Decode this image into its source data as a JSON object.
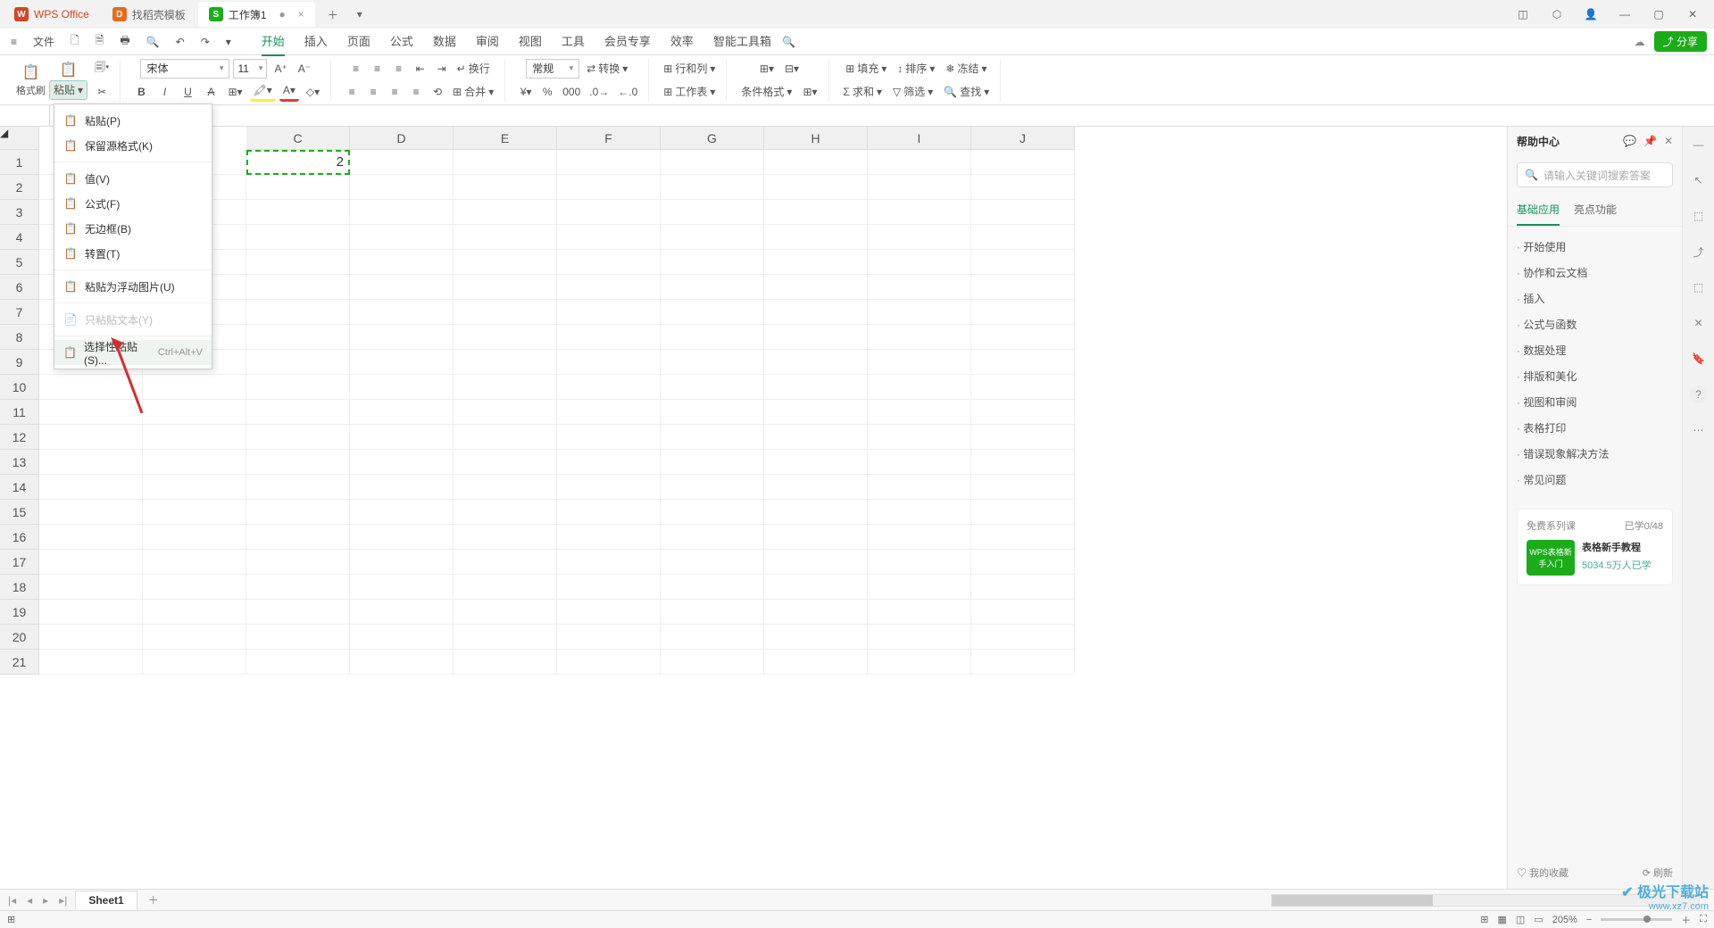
{
  "titlebar": {
    "app_name": "WPS Office",
    "template_tab": "找稻壳模板",
    "doc_tab": "工作簿1"
  },
  "file_menu_label": "文件",
  "menu_tabs": [
    "开始",
    "插入",
    "页面",
    "公式",
    "数据",
    "审阅",
    "视图",
    "工具",
    "会员专享",
    "效率",
    "智能工具箱"
  ],
  "active_menu_tab": 0,
  "share_label": "分享",
  "ribbon": {
    "format_painter": "格式刷",
    "paste": "粘贴",
    "font_name": "宋体",
    "font_size": "11",
    "wrap": "换行",
    "number_format": "常规",
    "convert": "转换",
    "rowcol": "行和列",
    "worksheet": "工作表",
    "cond_format": "条件格式",
    "fill": "填充",
    "sort": "排序",
    "freeze": "冻结",
    "sum": "求和",
    "filter": "筛选",
    "find": "查找",
    "merge": "合并"
  },
  "paste_menu": {
    "items": [
      {
        "label": "粘贴(P)",
        "icon": "📋"
      },
      {
        "label": "保留源格式(K)",
        "icon": "📋"
      },
      {
        "label": "值(V)",
        "icon": "📋"
      },
      {
        "label": "公式(F)",
        "icon": "📋"
      },
      {
        "label": "无边框(B)",
        "icon": "📋"
      },
      {
        "label": "转置(T)",
        "icon": "📋"
      },
      {
        "label": "粘贴为浮动图片(U)",
        "icon": "📋"
      },
      {
        "label": "只粘贴文本(Y)",
        "icon": "📄",
        "disabled": true
      },
      {
        "label": "选择性粘贴(S)...",
        "icon": "📋",
        "shortcut": "Ctrl+Alt+V",
        "hover": true
      }
    ]
  },
  "columns": [
    "C",
    "D",
    "E",
    "F",
    "G",
    "H",
    "I",
    "J"
  ],
  "row_count": 21,
  "cell_c1": "2",
  "help": {
    "title": "帮助中心",
    "search_placeholder": "请输入关键词搜索答案",
    "tabs": [
      "基础应用",
      "亮点功能"
    ],
    "links": [
      "开始使用",
      "协作和云文档",
      "插入",
      "公式与函数",
      "数据处理",
      "排版和美化",
      "视图和审阅",
      "表格打印",
      "错误现象解决方法",
      "常见问题"
    ],
    "course_section": "免费系列课",
    "course_progress": "已学0/48",
    "course_thumb": "WPS表格新手入门",
    "course_title": "表格新手教程",
    "course_count": "5034.5万人已学"
  },
  "sheet_tabs": {
    "sheet1": "Sheet1"
  },
  "statusbar": {
    "favorites": "我的收藏",
    "refresh": "刷新",
    "zoom": "205%"
  },
  "watermark": {
    "site": "极光下载站",
    "url": "www.xz7.com"
  }
}
